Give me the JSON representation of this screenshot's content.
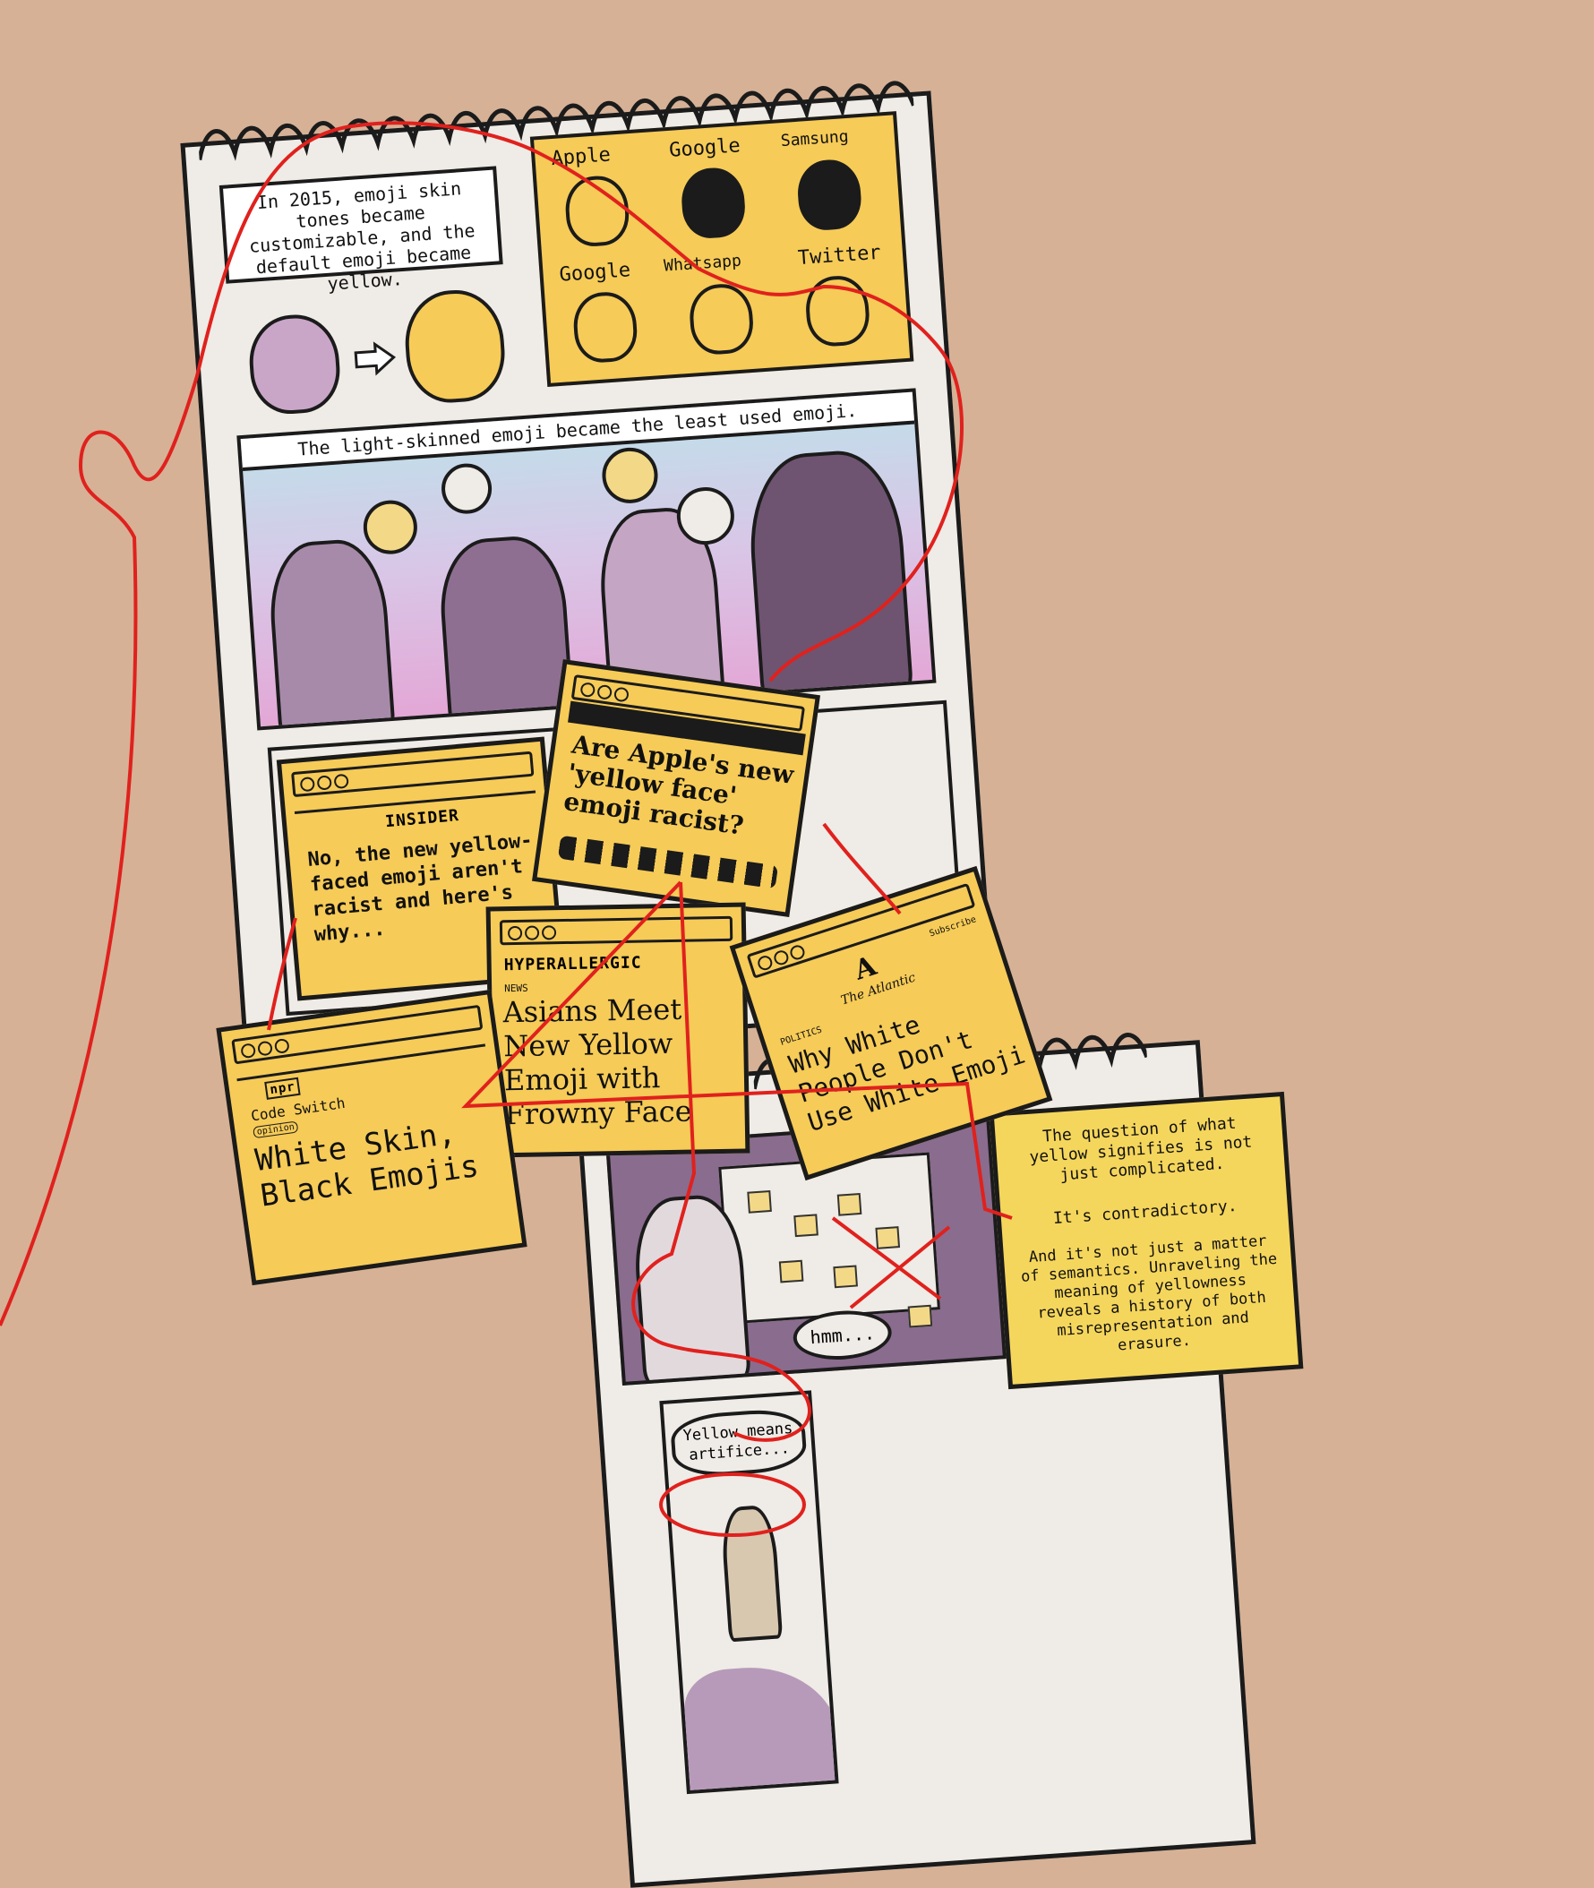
{
  "colors": {
    "background": "#d6b196",
    "paper": "#efebe6",
    "sticky_yellow": "#f6cb57",
    "ink": "#1b1b1b",
    "red_string": "#e0211d",
    "purple_shade": "#a78aa9"
  },
  "top_strip": {
    "caption_intro": "In 2015, emoji skin tones became customizable, and the default emoji became yellow.",
    "emoji_grid": {
      "labels": [
        "Apple",
        "Google",
        "Samsung",
        "Google",
        "Whatsapp",
        "Twitter"
      ]
    },
    "caption_least_used": "The light-skinned emoji became the least used emoji.",
    "bubble_icons": [
      "thumbs-up-icon",
      "wave-hand-icon",
      "fist-icon",
      "raised-hand-icon"
    ]
  },
  "articles": {
    "insider": {
      "brand": "INSIDER",
      "headline": "No, the new yellow-faced emoji aren't racist and here's why..."
    },
    "apple": {
      "headline": "Are Apple's new 'yellow face' emoji racist?"
    },
    "hyperallergic": {
      "brand": "HYPERALLERGIC",
      "section": "NEWS",
      "headline": "Asians Meet New Yellow Emoji with Frowny Face"
    },
    "npr": {
      "brand": "npr",
      "section": "Code Switch",
      "tag": "opinion",
      "headline": "White Skin, Black Emojis"
    },
    "atlantic": {
      "logo": "A",
      "brand": "The Atlantic",
      "subscribe": "Subscribe",
      "section": "POLITICS",
      "headline": "Why White People Don't Use White Emoji"
    }
  },
  "second_strip": {
    "caption_question": "The question of what yellow signifies is not just complicated.",
    "caption_contradictory": "It's contradictory.",
    "caption_semantics": "And it's not just a matter of semantics. Unraveling the meaning of yellowness reveals a history of both misrepresentation and erasure.",
    "speech_hmm": "hmm...",
    "speech_artifice": "Yellow means artifice..."
  }
}
